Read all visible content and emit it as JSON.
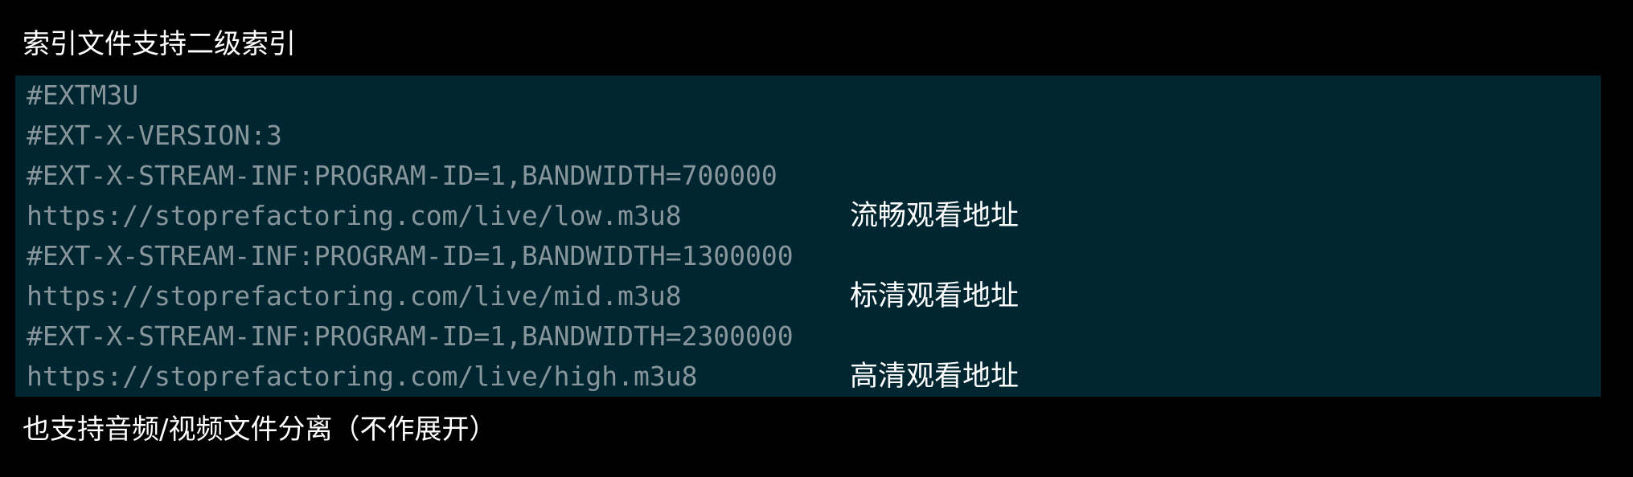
{
  "heading": "索引文件支持二级索引",
  "code_block": {
    "background": "#002731",
    "text_color": "#88969c",
    "lines": [
      "#EXTM3U",
      "#EXT-X-VERSION:3",
      "#EXT-X-STREAM-INF:PROGRAM-ID=1,BANDWIDTH=700000",
      "https://stoprefactoring.com/live/low.m3u8",
      "#EXT-X-STREAM-INF:PROGRAM-ID=1,BANDWIDTH=1300000",
      "https://stoprefactoring.com/live/mid.m3u8",
      "#EXT-X-STREAM-INF:PROGRAM-ID=1,BANDWIDTH=2300000",
      "https://stoprefactoring.com/live/high.m3u8"
    ]
  },
  "annotations": {
    "low": "流畅观看地址",
    "mid": "标清观看地址",
    "high": "高清观看地址"
  },
  "footer_note": "也支持音频/视频文件分离（不作展开）"
}
